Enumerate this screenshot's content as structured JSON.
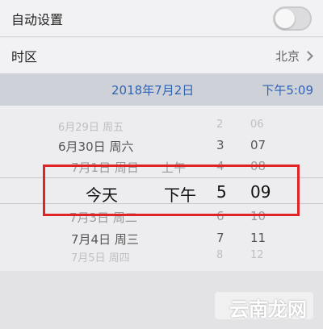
{
  "settings": {
    "auto_set_label": "自动设置",
    "auto_set_enabled": false,
    "timezone_label": "时区",
    "timezone_value": "北京"
  },
  "selected_display": {
    "date": "2018年7月2日",
    "time": "下午5:09"
  },
  "picker": {
    "rows": [
      {
        "date": "6月29日 周五",
        "ampm": "",
        "hour": "2",
        "minute": "06"
      },
      {
        "date": "6月30日 周六",
        "ampm": "",
        "hour": "3",
        "minute": "07"
      },
      {
        "date": "7月1日 周日",
        "ampm": "上午",
        "hour": "4",
        "minute": "08"
      },
      {
        "date": "今天",
        "ampm": "下午",
        "hour": "5",
        "minute": "09"
      },
      {
        "date": "7月3日 周二",
        "ampm": "",
        "hour": "6",
        "minute": "10"
      },
      {
        "date": "7月4日 周三",
        "ampm": "",
        "hour": "7",
        "minute": "11"
      },
      {
        "date": "7月5日 周四",
        "ampm": "",
        "hour": "8",
        "minute": "12"
      }
    ]
  },
  "watermark": "云南龙网"
}
